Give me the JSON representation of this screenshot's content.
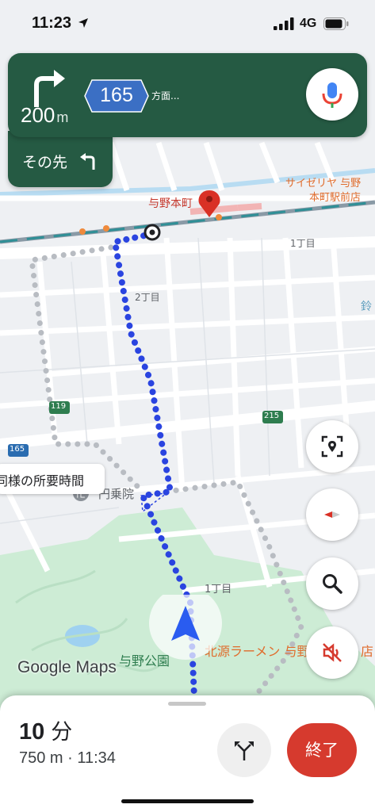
{
  "status_bar": {
    "time": "11:23",
    "network": "4G"
  },
  "navigation": {
    "distance_value": "200",
    "distance_unit": "m",
    "route_number": "165",
    "direction_text": "方面...",
    "then_label": "その先"
  },
  "map": {
    "labels": {
      "station": "与野本町",
      "restaurant_1": "サイゼリヤ 与野",
      "restaurant_2": "本町駅前店",
      "chome1_top": "1丁目",
      "chome2": "2丁目",
      "chome1_bottom": "1丁目",
      "temple": "円乗院",
      "park": "与野公園",
      "ramen": "北源ラーメン 与野",
      "ramen_suffix": "店",
      "road_119": "119",
      "road_215": "215",
      "road_165": "165",
      "partial_right": "鈴"
    },
    "same_time_bubble": "同様の所要時間",
    "attribution": "Google Maps"
  },
  "colors": {
    "nav_green": "#255a43",
    "route_blue": "#2a44e0",
    "end_red": "#d63a2e",
    "marker_red": "#d93025"
  },
  "trip": {
    "eta_value": "10",
    "eta_unit": "分",
    "detail": "750 m · 11:34"
  },
  "buttons": {
    "end_label": "終了"
  },
  "icons": {
    "turn": "turn-right-icon",
    "then": "turn-left-icon",
    "mic": "microphone-icon",
    "report": "report-location-icon",
    "compass": "compass-icon",
    "search": "search-icon",
    "sound": "sound-off-icon",
    "alternate": "alternate-routes-icon"
  }
}
